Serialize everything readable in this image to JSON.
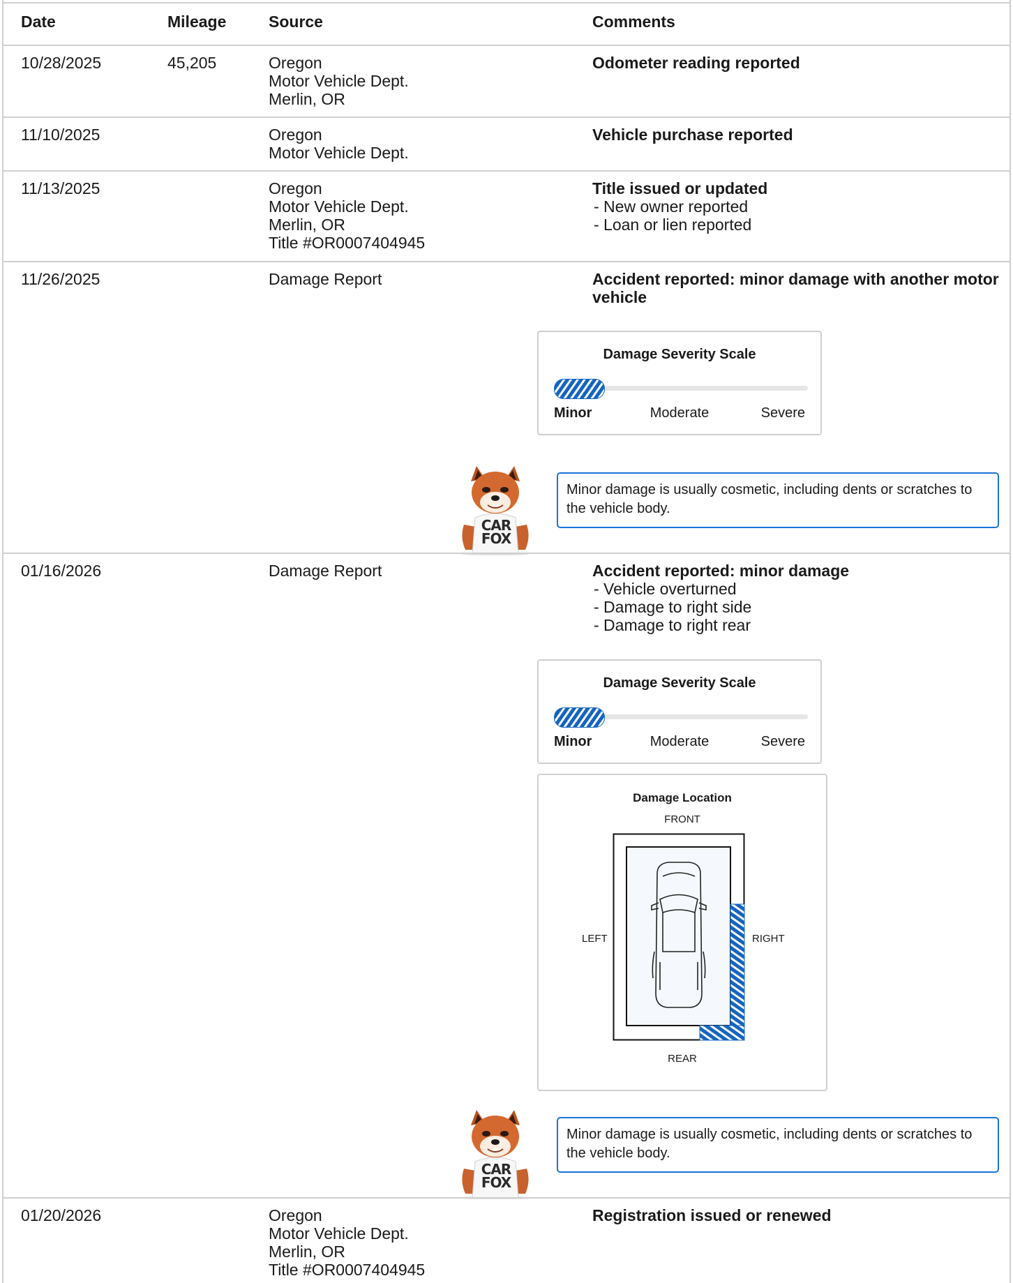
{
  "headers": {
    "date": "Date",
    "mileage": "Mileage",
    "source": "Source",
    "comments": "Comments"
  },
  "rows": [
    {
      "date": "10/28/2025",
      "mileage": "45,205",
      "source": "Oregon\nMotor Vehicle Dept.\nMerlin, OR",
      "comment_title": "Odometer reading reported",
      "comment_items": ""
    },
    {
      "date": "11/10/2025",
      "mileage": "",
      "source": "Oregon\nMotor Vehicle Dept.",
      "comment_title": "Vehicle purchase reported",
      "comment_items": ""
    },
    {
      "date": "11/13/2025",
      "mileage": "",
      "source": "Oregon\nMotor Vehicle Dept.\nMerlin, OR\nTitle #OR0007404945",
      "comment_title": "Title issued or updated",
      "comment_items": "- New owner reported\n- Loan or lien reported"
    },
    {
      "date": "11/26/2025",
      "mileage": "",
      "source": "Damage Report",
      "comment_title": "Accident reported: minor damage with another motor\nvehicle",
      "comment_items": "",
      "severity": {
        "title": "Damage Severity Scale",
        "labels": [
          "Minor",
          "Moderate",
          "Severe"
        ],
        "level": "Minor",
        "fill_fraction": 0.2
      },
      "tip": "Minor damage is usually cosmetic, including dents or scratches to\nthe vehicle body."
    },
    {
      "date": "01/16/2026",
      "mileage": "",
      "source": "Damage Report",
      "comment_title": "Accident reported: minor damage",
      "comment_items": "- Vehicle overturned\n- Damage to right side\n- Damage to right rear",
      "severity": {
        "title": "Damage Severity Scale",
        "labels": [
          "Minor",
          "Moderate",
          "Severe"
        ],
        "level": "Minor",
        "fill_fraction": 0.2
      },
      "location": {
        "title": "Damage Location",
        "front": "FRONT",
        "rear": "REAR",
        "left": "LEFT",
        "right": "RIGHT",
        "damaged_zones": [
          "right-side",
          "right-rear"
        ]
      },
      "tip": "Minor damage is usually cosmetic, including dents or scratches to\nthe vehicle body."
    },
    {
      "date": "01/20/2026",
      "mileage": "",
      "source": "Oregon\nMotor Vehicle Dept.\nMerlin, OR\nTitle #OR0007404945",
      "comment_title": "Registration issued or renewed",
      "comment_items": ""
    }
  ],
  "mascot": {
    "shirt_text_line1": "CAR",
    "shirt_text_line2": "FOX"
  },
  "colors": {
    "accent_blue": "#1565c0",
    "tip_border": "#1a73d9",
    "grid_line": "#cfcfcf"
  }
}
